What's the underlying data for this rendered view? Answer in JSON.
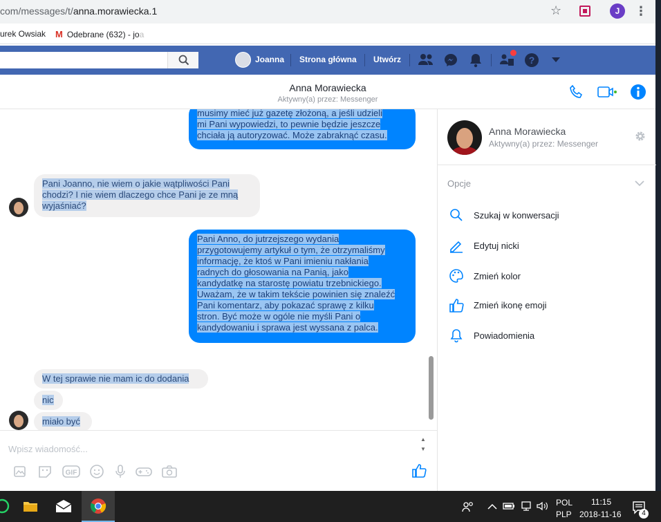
{
  "browser": {
    "url_prefix": "com/messages/t/",
    "url_rest": "anna.morawiecka.1",
    "avatar_letter": "J",
    "bookmarks": [
      {
        "label": "urek Owsiak"
      },
      {
        "label": "Odebrane (632) - jo",
        "faded": "a"
      }
    ]
  },
  "fb_bar": {
    "nav": [
      "Joanna",
      "Strona główna",
      "Utwórz"
    ],
    "accent": "#4267b2"
  },
  "conversation": {
    "name": "Anna Morawiecka",
    "status": "Aktywny(a) przez: Messenger"
  },
  "messages": [
    {
      "dir": "out",
      "lines": [
        "musimy mieć już gazetę złożoną, a jeśli udzieli",
        "mi Pani wypowiedzi, to pewnie będzie jeszcze",
        "chciała ją autoryzować. Może zabraknąć czasu."
      ]
    },
    {
      "dir": "in",
      "lines": [
        "Pani Joanno, nie wiem o jakie wątpliwości Pani",
        "chodzi? I nie wiem dlaczego chce Pani je ze mną",
        "wyjaśniać?"
      ]
    },
    {
      "dir": "out",
      "lines": [
        "Pani Anno, do jutrzejszego wydania",
        "przygotowujemy artykuł o tym, że otrzymaliśmy",
        "informację, że ktoś w Pani imieniu nakłania",
        "radnych do głosowania na Panią, jako",
        "kandydatkę na starostę powiatu trzebnickiego.",
        "Uważam, że w takim tekście powinien się znaleźć",
        "Pani komentarz, aby pokazać sprawę z kilku",
        "stron. Być może w ogóle nie myśli Pani o",
        "kandydowaniu i sprawa jest wyssana z palca."
      ]
    },
    {
      "dir": "in",
      "lines": [
        "W tej sprawie nie mam ic do dodania"
      ]
    },
    {
      "dir": "in",
      "lines": [
        "nic"
      ]
    },
    {
      "dir": "in",
      "lines": [
        "miało być"
      ]
    }
  ],
  "composer": {
    "placeholder": "Wpisz wiadomość..."
  },
  "right_panel": {
    "name": "Anna Morawiecka",
    "status": "Aktywny(a) przez: Messenger",
    "options_label": "Opcje",
    "items": [
      {
        "icon": "search-icon",
        "label": "Szukaj w konwersacji"
      },
      {
        "icon": "pencil-icon",
        "label": "Edytuj nicki"
      },
      {
        "icon": "palette-icon",
        "label": "Zmień kolor"
      },
      {
        "icon": "thumbs-up-icon",
        "label": "Zmień ikonę emoji"
      },
      {
        "icon": "bell-icon",
        "label": "Powiadomienia"
      }
    ]
  },
  "taskbar": {
    "lang1": "POL",
    "lang2": "PLP",
    "time": "11:15",
    "date": "2018-11-16",
    "notif_count": "4"
  }
}
